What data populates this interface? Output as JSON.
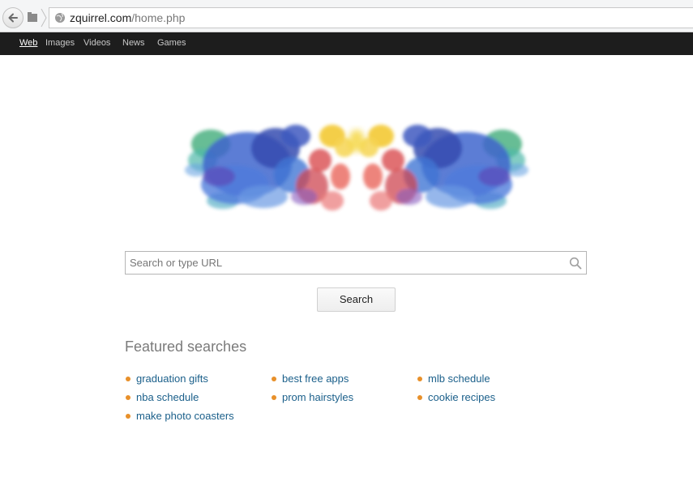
{
  "browser": {
    "url_domain": "zquirrel.com",
    "url_path": "/home.php"
  },
  "nav": {
    "items": [
      "Web",
      "Images",
      "Videos",
      "News",
      "Games"
    ],
    "active": "Web"
  },
  "search": {
    "placeholder": "Search or type URL",
    "button_label": "Search"
  },
  "featured": {
    "title": "Featured searches",
    "links": [
      "graduation gifts",
      "best free apps",
      "mlb schedule",
      "nba schedule",
      "prom hairstyles",
      "cookie recipes",
      "make photo coasters"
    ]
  },
  "colors": {
    "link": "#1a5f8a",
    "bullet": "#e8902a",
    "navbar": "#1d1d1d"
  }
}
